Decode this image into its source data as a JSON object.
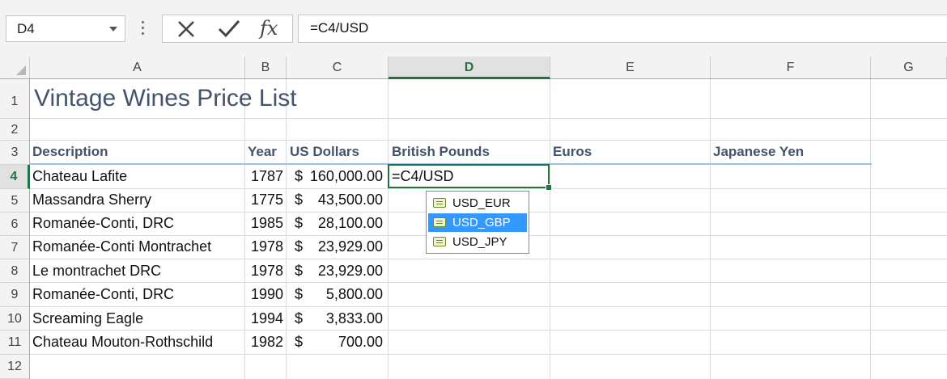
{
  "formula_bar": {
    "name_box": "D4",
    "formula": "=C4/USD",
    "fx_label": "fx"
  },
  "columns": [
    "A",
    "B",
    "C",
    "D",
    "E",
    "F",
    "G"
  ],
  "selected_column": "D",
  "rows": [
    "1",
    "2",
    "3",
    "4",
    "5",
    "6",
    "7",
    "8",
    "9",
    "10",
    "11",
    "12"
  ],
  "selected_row": "4",
  "sheet": {
    "title": "Vintage Wines Price List",
    "headers": {
      "description": "Description",
      "year": "Year",
      "usd": "US Dollars",
      "gbp": "British Pounds",
      "eur": "Euros",
      "jpy": "Japanese Yen"
    },
    "data_rows": [
      {
        "description": "Chateau Lafite",
        "year": "1787",
        "currency": "$",
        "amount": "160,000.00"
      },
      {
        "description": "Massandra Sherry",
        "year": "1775",
        "currency": "$",
        "amount": "43,500.00"
      },
      {
        "description": "Romanée-Conti, DRC",
        "year": "1985",
        "currency": "$",
        "amount": "28,100.00"
      },
      {
        "description": "Romanée-Conti Montrachet",
        "year": "1978",
        "currency": "$",
        "amount": "23,929.00"
      },
      {
        "description": "Le montrachet DRC",
        "year": "1978",
        "currency": "$",
        "amount": "23,929.00"
      },
      {
        "description": "Romanée-Conti, DRC",
        "year": "1990",
        "currency": "$",
        "amount": "5,800.00"
      },
      {
        "description": "Screaming Eagle",
        "year": "1994",
        "currency": "$",
        "amount": "3,833.00"
      },
      {
        "description": "Chateau Mouton-Rothschild",
        "year": "1982",
        "currency": "$",
        "amount": "700.00"
      }
    ],
    "active_cell_text": "=C4/USD"
  },
  "autocomplete": {
    "items": [
      "USD_EUR",
      "USD_GBP",
      "USD_JPY"
    ],
    "selected_index": 1
  },
  "colors": {
    "accent_green": "#217346",
    "header_text": "#44546a",
    "autocomplete_highlight": "#3399ff"
  }
}
